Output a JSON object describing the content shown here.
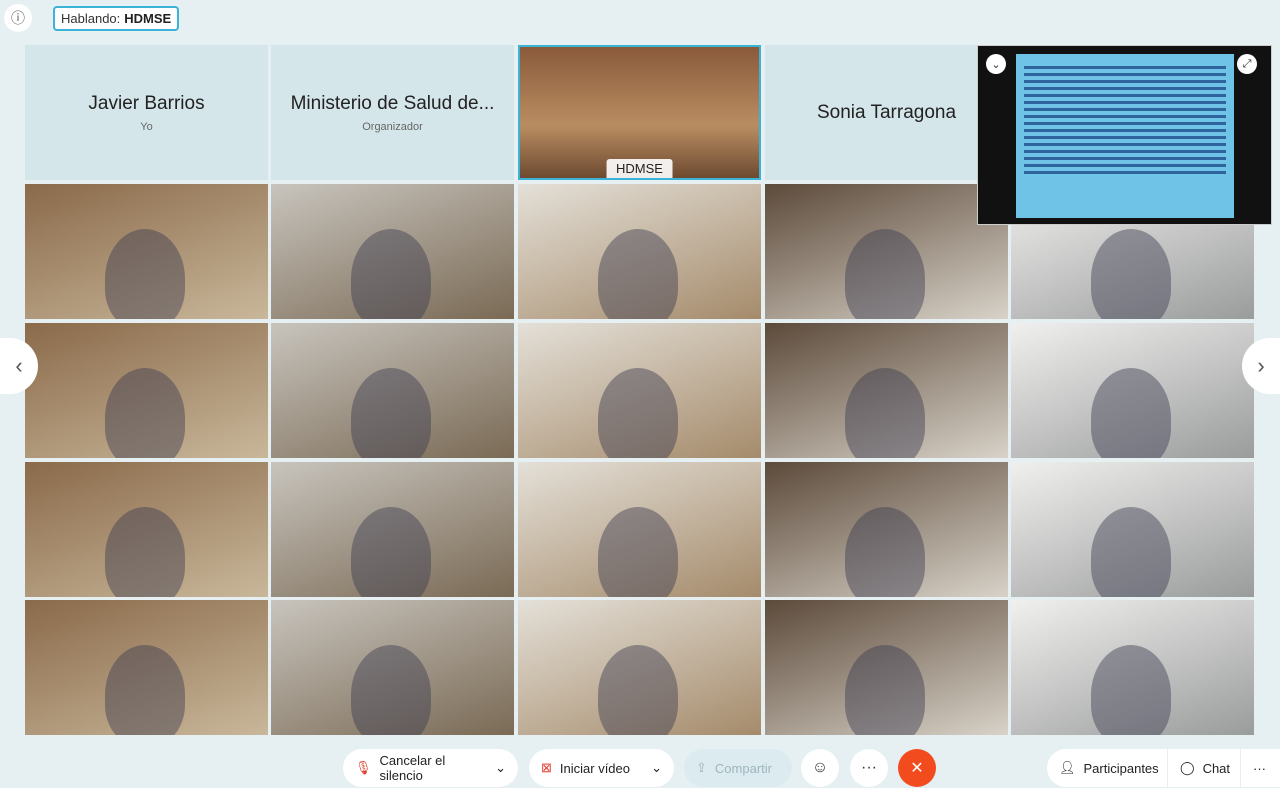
{
  "speaking": {
    "label": "Hablando:",
    "name": "HDMSE"
  },
  "tiles": [
    {
      "name": "Javier Barrios",
      "role": "Yo"
    },
    {
      "name": "Ministerio de Salud de...",
      "role": "Organizador"
    },
    {
      "video_label": "HDMSE"
    },
    {
      "name": "Sonia Tarragona"
    }
  ],
  "toolbar": {
    "unmute": "Cancelar el silencio",
    "start_video": "Iniciar vídeo",
    "share": "Compartir",
    "participants": "Participantes",
    "chat": "Chat",
    "more": "···"
  },
  "icons": {
    "info": "info-icon",
    "unmute": "muted-microphone-icon",
    "video": "video-off-icon",
    "share": "share-icon",
    "reactions": "emoji-icon",
    "end": "close-icon",
    "participants": "participants-icon",
    "chat": "chat-bubble-icon"
  },
  "colors": {
    "accent": "#3bb3d6",
    "end_call": "#f24b1e"
  }
}
